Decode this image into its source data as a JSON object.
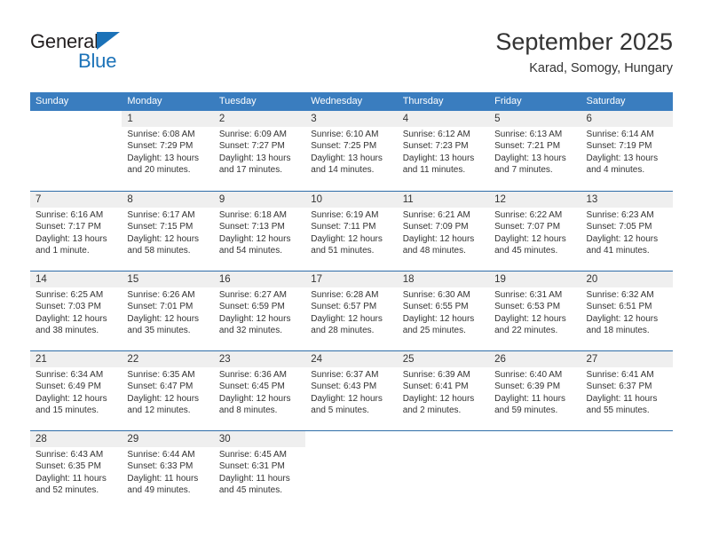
{
  "brand": {
    "name_top": "General",
    "name_bottom": "Blue",
    "accent_color": "#1b72b8"
  },
  "header": {
    "title": "September 2025",
    "subtitle": "Karad, Somogy, Hungary"
  },
  "calendar": {
    "header_color": "#3a7dbf",
    "band_color": "#efefef",
    "rule_color": "#2f6da8",
    "weekday_headers": [
      "Sunday",
      "Monday",
      "Tuesday",
      "Wednesday",
      "Thursday",
      "Friday",
      "Saturday"
    ],
    "weeks": [
      [
        {
          "day": "",
          "sunrise": "",
          "sunset": "",
          "daylight_1": "",
          "daylight_2": ""
        },
        {
          "day": "1",
          "sunrise": "Sunrise: 6:08 AM",
          "sunset": "Sunset: 7:29 PM",
          "daylight_1": "Daylight: 13 hours",
          "daylight_2": "and 20 minutes."
        },
        {
          "day": "2",
          "sunrise": "Sunrise: 6:09 AM",
          "sunset": "Sunset: 7:27 PM",
          "daylight_1": "Daylight: 13 hours",
          "daylight_2": "and 17 minutes."
        },
        {
          "day": "3",
          "sunrise": "Sunrise: 6:10 AM",
          "sunset": "Sunset: 7:25 PM",
          "daylight_1": "Daylight: 13 hours",
          "daylight_2": "and 14 minutes."
        },
        {
          "day": "4",
          "sunrise": "Sunrise: 6:12 AM",
          "sunset": "Sunset: 7:23 PM",
          "daylight_1": "Daylight: 13 hours",
          "daylight_2": "and 11 minutes."
        },
        {
          "day": "5",
          "sunrise": "Sunrise: 6:13 AM",
          "sunset": "Sunset: 7:21 PM",
          "daylight_1": "Daylight: 13 hours",
          "daylight_2": "and 7 minutes."
        },
        {
          "day": "6",
          "sunrise": "Sunrise: 6:14 AM",
          "sunset": "Sunset: 7:19 PM",
          "daylight_1": "Daylight: 13 hours",
          "daylight_2": "and 4 minutes."
        }
      ],
      [
        {
          "day": "7",
          "sunrise": "Sunrise: 6:16 AM",
          "sunset": "Sunset: 7:17 PM",
          "daylight_1": "Daylight: 13 hours",
          "daylight_2": "and 1 minute."
        },
        {
          "day": "8",
          "sunrise": "Sunrise: 6:17 AM",
          "sunset": "Sunset: 7:15 PM",
          "daylight_1": "Daylight: 12 hours",
          "daylight_2": "and 58 minutes."
        },
        {
          "day": "9",
          "sunrise": "Sunrise: 6:18 AM",
          "sunset": "Sunset: 7:13 PM",
          "daylight_1": "Daylight: 12 hours",
          "daylight_2": "and 54 minutes."
        },
        {
          "day": "10",
          "sunrise": "Sunrise: 6:19 AM",
          "sunset": "Sunset: 7:11 PM",
          "daylight_1": "Daylight: 12 hours",
          "daylight_2": "and 51 minutes."
        },
        {
          "day": "11",
          "sunrise": "Sunrise: 6:21 AM",
          "sunset": "Sunset: 7:09 PM",
          "daylight_1": "Daylight: 12 hours",
          "daylight_2": "and 48 minutes."
        },
        {
          "day": "12",
          "sunrise": "Sunrise: 6:22 AM",
          "sunset": "Sunset: 7:07 PM",
          "daylight_1": "Daylight: 12 hours",
          "daylight_2": "and 45 minutes."
        },
        {
          "day": "13",
          "sunrise": "Sunrise: 6:23 AM",
          "sunset": "Sunset: 7:05 PM",
          "daylight_1": "Daylight: 12 hours",
          "daylight_2": "and 41 minutes."
        }
      ],
      [
        {
          "day": "14",
          "sunrise": "Sunrise: 6:25 AM",
          "sunset": "Sunset: 7:03 PM",
          "daylight_1": "Daylight: 12 hours",
          "daylight_2": "and 38 minutes."
        },
        {
          "day": "15",
          "sunrise": "Sunrise: 6:26 AM",
          "sunset": "Sunset: 7:01 PM",
          "daylight_1": "Daylight: 12 hours",
          "daylight_2": "and 35 minutes."
        },
        {
          "day": "16",
          "sunrise": "Sunrise: 6:27 AM",
          "sunset": "Sunset: 6:59 PM",
          "daylight_1": "Daylight: 12 hours",
          "daylight_2": "and 32 minutes."
        },
        {
          "day": "17",
          "sunrise": "Sunrise: 6:28 AM",
          "sunset": "Sunset: 6:57 PM",
          "daylight_1": "Daylight: 12 hours",
          "daylight_2": "and 28 minutes."
        },
        {
          "day": "18",
          "sunrise": "Sunrise: 6:30 AM",
          "sunset": "Sunset: 6:55 PM",
          "daylight_1": "Daylight: 12 hours",
          "daylight_2": "and 25 minutes."
        },
        {
          "day": "19",
          "sunrise": "Sunrise: 6:31 AM",
          "sunset": "Sunset: 6:53 PM",
          "daylight_1": "Daylight: 12 hours",
          "daylight_2": "and 22 minutes."
        },
        {
          "day": "20",
          "sunrise": "Sunrise: 6:32 AM",
          "sunset": "Sunset: 6:51 PM",
          "daylight_1": "Daylight: 12 hours",
          "daylight_2": "and 18 minutes."
        }
      ],
      [
        {
          "day": "21",
          "sunrise": "Sunrise: 6:34 AM",
          "sunset": "Sunset: 6:49 PM",
          "daylight_1": "Daylight: 12 hours",
          "daylight_2": "and 15 minutes."
        },
        {
          "day": "22",
          "sunrise": "Sunrise: 6:35 AM",
          "sunset": "Sunset: 6:47 PM",
          "daylight_1": "Daylight: 12 hours",
          "daylight_2": "and 12 minutes."
        },
        {
          "day": "23",
          "sunrise": "Sunrise: 6:36 AM",
          "sunset": "Sunset: 6:45 PM",
          "daylight_1": "Daylight: 12 hours",
          "daylight_2": "and 8 minutes."
        },
        {
          "day": "24",
          "sunrise": "Sunrise: 6:37 AM",
          "sunset": "Sunset: 6:43 PM",
          "daylight_1": "Daylight: 12 hours",
          "daylight_2": "and 5 minutes."
        },
        {
          "day": "25",
          "sunrise": "Sunrise: 6:39 AM",
          "sunset": "Sunset: 6:41 PM",
          "daylight_1": "Daylight: 12 hours",
          "daylight_2": "and 2 minutes."
        },
        {
          "day": "26",
          "sunrise": "Sunrise: 6:40 AM",
          "sunset": "Sunset: 6:39 PM",
          "daylight_1": "Daylight: 11 hours",
          "daylight_2": "and 59 minutes."
        },
        {
          "day": "27",
          "sunrise": "Sunrise: 6:41 AM",
          "sunset": "Sunset: 6:37 PM",
          "daylight_1": "Daylight: 11 hours",
          "daylight_2": "and 55 minutes."
        }
      ],
      [
        {
          "day": "28",
          "sunrise": "Sunrise: 6:43 AM",
          "sunset": "Sunset: 6:35 PM",
          "daylight_1": "Daylight: 11 hours",
          "daylight_2": "and 52 minutes."
        },
        {
          "day": "29",
          "sunrise": "Sunrise: 6:44 AM",
          "sunset": "Sunset: 6:33 PM",
          "daylight_1": "Daylight: 11 hours",
          "daylight_2": "and 49 minutes."
        },
        {
          "day": "30",
          "sunrise": "Sunrise: 6:45 AM",
          "sunset": "Sunset: 6:31 PM",
          "daylight_1": "Daylight: 11 hours",
          "daylight_2": "and 45 minutes."
        },
        {
          "day": "",
          "sunrise": "",
          "sunset": "",
          "daylight_1": "",
          "daylight_2": ""
        },
        {
          "day": "",
          "sunrise": "",
          "sunset": "",
          "daylight_1": "",
          "daylight_2": ""
        },
        {
          "day": "",
          "sunrise": "",
          "sunset": "",
          "daylight_1": "",
          "daylight_2": ""
        },
        {
          "day": "",
          "sunrise": "",
          "sunset": "",
          "daylight_1": "",
          "daylight_2": ""
        }
      ]
    ]
  }
}
